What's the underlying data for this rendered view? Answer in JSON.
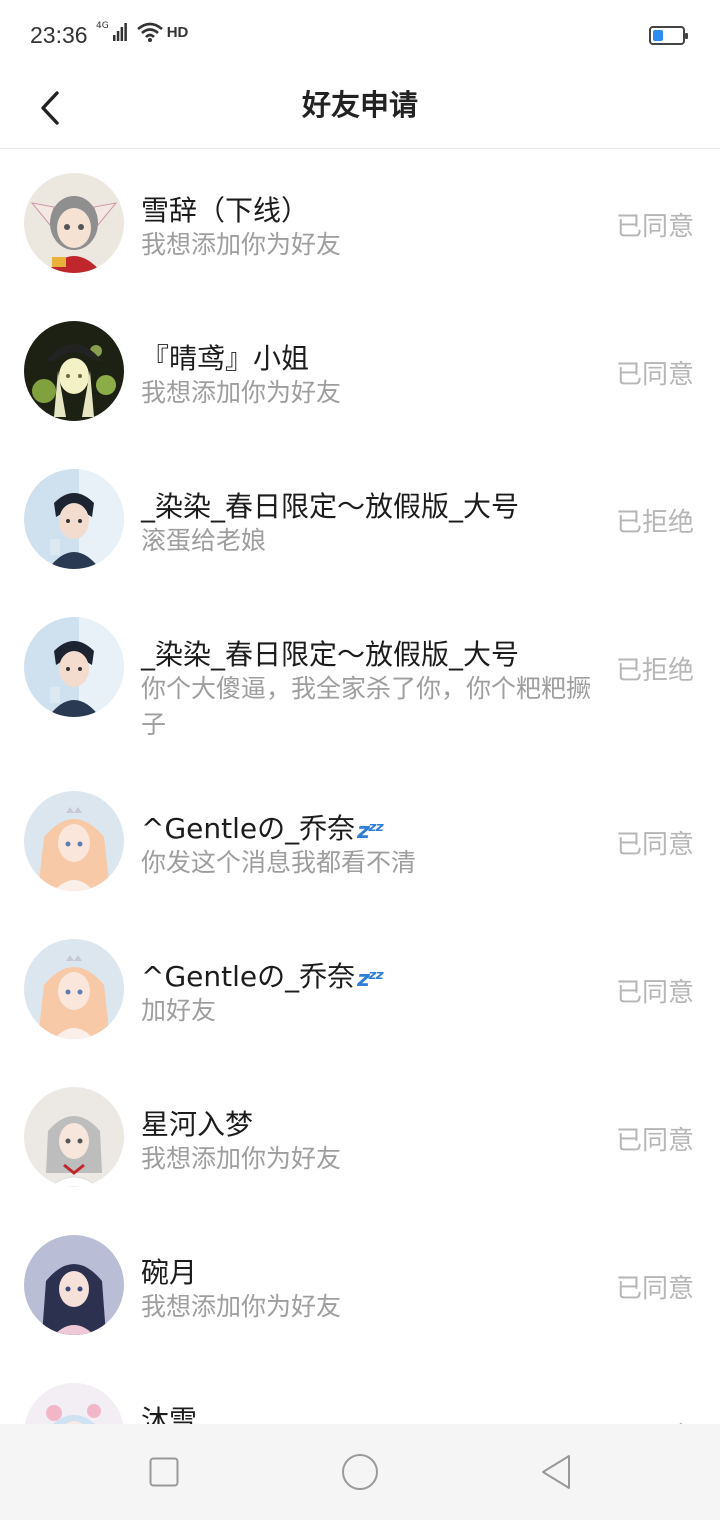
{
  "status_bar": {
    "time": "23:36",
    "network_label": "4G",
    "hd_label": "HD"
  },
  "header": {
    "title": "好友申请"
  },
  "requests": [
    {
      "name": "雪辞（下线）",
      "message": "我想添加你为好友",
      "status": "已同意"
    },
    {
      "name": "『晴鸢』小姐",
      "message": "我想添加你为好友",
      "status": "已同意"
    },
    {
      "name": "_染染_春日限定～放假版_大号",
      "message": "滚蛋给老娘",
      "status": "已拒绝"
    },
    {
      "name": "_染染_春日限定～放假版_大号",
      "message": "你个大傻逼，我全家杀了你，你个粑粑撅子",
      "status": "已拒绝"
    },
    {
      "name": "^Gentleの_乔奈",
      "message": "你发这个消息我都看不清",
      "status": "已同意"
    },
    {
      "name": "^Gentleの_乔奈",
      "message": "加好友",
      "status": "已同意"
    },
    {
      "name": "星河入梦",
      "message": "我想添加你为好友",
      "status": "已同意"
    },
    {
      "name": "碗月",
      "message": "我想添加你为好友",
      "status": "已同意"
    },
    {
      "name": "沐雪",
      "message": "",
      "status": "已同意"
    }
  ],
  "colors": {
    "status_text": "#b6b6b6",
    "message_text": "#9e9e9e",
    "battery_fill": "#2a8ef0"
  }
}
